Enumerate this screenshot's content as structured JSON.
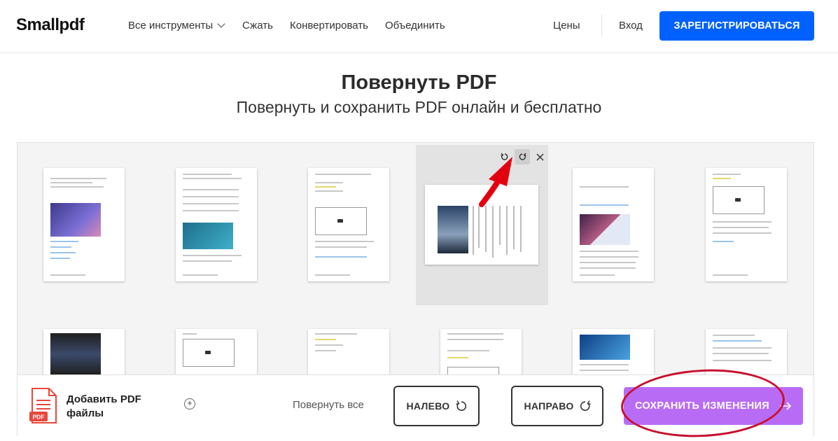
{
  "header": {
    "logo": "Smallpdf",
    "nav": {
      "all_tools": "Все инструменты",
      "compress": "Сжать",
      "convert": "Конвертировать",
      "merge": "Объединить",
      "pricing": "Цены",
      "login": "Вход"
    },
    "signup_label": "ЗАРЕГИСТРИРОВАТЬСЯ"
  },
  "title": "Повернуть PDF",
  "subtitle": "Повернуть и сохранить PDF онлайн и бесплатно",
  "toolbar": {
    "add_pdf_label": "Добавить PDF файлы",
    "rotate_all_label": "Повернуть все",
    "left_label": "НАЛЕВО",
    "right_label": "НАПРАВО",
    "save_label": "СОХРАНИТЬ ИЗМЕНЕНИЯ"
  },
  "icons": {
    "rotate_left": "rotate-ccw-icon",
    "rotate_right": "rotate-cw-icon",
    "close": "close-icon",
    "add": "plus-icon",
    "arrow": "arrow-right-icon"
  },
  "colors": {
    "primary": "#0061fe",
    "save": "#b86cf5",
    "annotation": "#e3000f"
  }
}
